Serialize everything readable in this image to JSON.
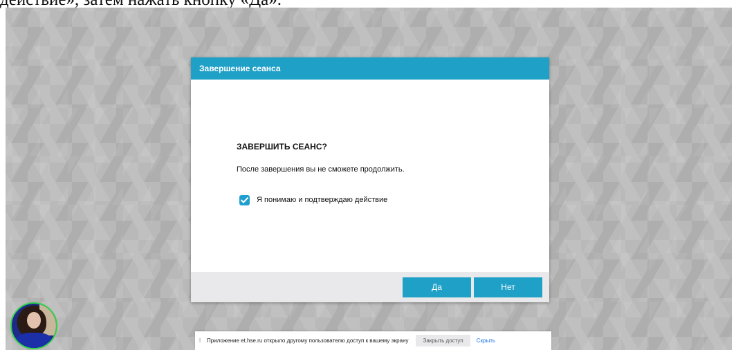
{
  "document": {
    "text": "действие», затем нажать кнопку «Да»."
  },
  "modal": {
    "title": "Завершение сеанса",
    "heading": "ЗАВЕРШИТЬ СЕАНС?",
    "message": "После завершения вы не сможете продолжить.",
    "confirm_label": "Я понимаю и подтверждаю действие",
    "confirm_checked": true,
    "yes_label": "Да",
    "no_label": "Нет"
  },
  "share_bar": {
    "grip_icon": "drag-handle-icon",
    "message": "Приложение et.hse.ru открыло другому пользователю доступ к вашему экрану",
    "stop_label": "Закрыть доступ",
    "hide_label": "Скрыть"
  },
  "colors": {
    "accent": "#1fa0c6",
    "avatar_ring": "#2fd24a",
    "link": "#1a73e8"
  }
}
